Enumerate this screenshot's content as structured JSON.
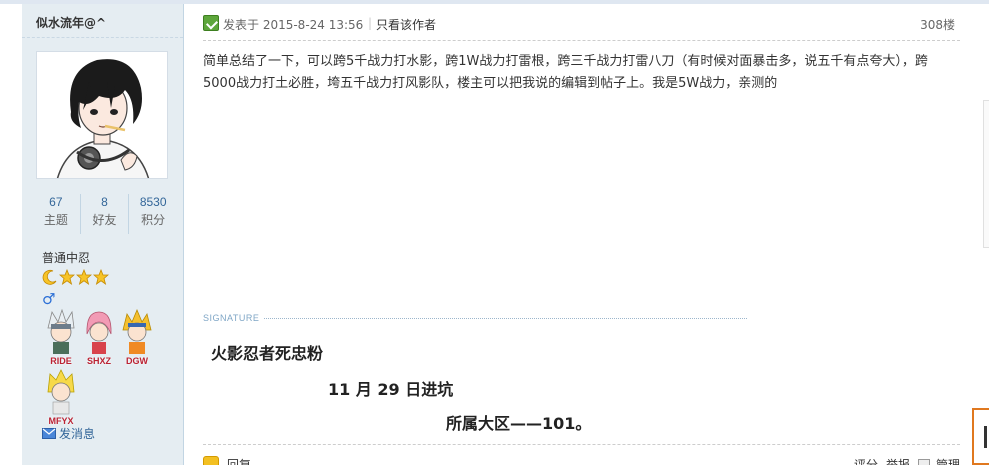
{
  "author": {
    "name": "似水流年@^",
    "stats": [
      {
        "value": "67",
        "label": "主题"
      },
      {
        "value": "8",
        "label": "好友"
      },
      {
        "value": "8530",
        "label": "积分"
      }
    ],
    "rank": "普通中忍",
    "rank_icons": [
      "moon-icon",
      "star-icon",
      "star-icon",
      "star-icon"
    ],
    "gender_symbol": "♂",
    "medals": [
      {
        "label": "RIDE",
        "icon": "kakashi-medal-icon"
      },
      {
        "label": "SHXZ",
        "icon": "sakura-medal-icon"
      },
      {
        "label": "DGW",
        "icon": "naruto-medal-icon"
      },
      {
        "label": "MFYX",
        "icon": "minato-medal-icon"
      }
    ],
    "send_message_label": "发消息"
  },
  "post": {
    "posted_at": "发表于 2015-8-24 13:56",
    "separator": "|",
    "only_author_label": "只看该作者",
    "floor": "308楼",
    "body": "简单总结了一下，可以跨5千战力打水影，跨1W战力打雷根，跨三千战力打雷八刀（有时候对面暴击多，说五千有点夸大），跨5000战力打土必胜，垮五千战力打风影队，楼主可以把我说的编辑到帖子上。我是5W战力，亲测的"
  },
  "signature": {
    "label": "SIGNATURE",
    "lines": [
      "火影忍者死忠粉",
      "11 月 29 日进坑",
      "所属大区——101。"
    ]
  },
  "footer": {
    "reply_label": "回复",
    "actions": [
      "评分",
      "举报",
      "管理"
    ]
  },
  "colors": {
    "sidebar_bg": "#e5edf2",
    "link": "#336699",
    "accent_orange": "#e0781f"
  }
}
